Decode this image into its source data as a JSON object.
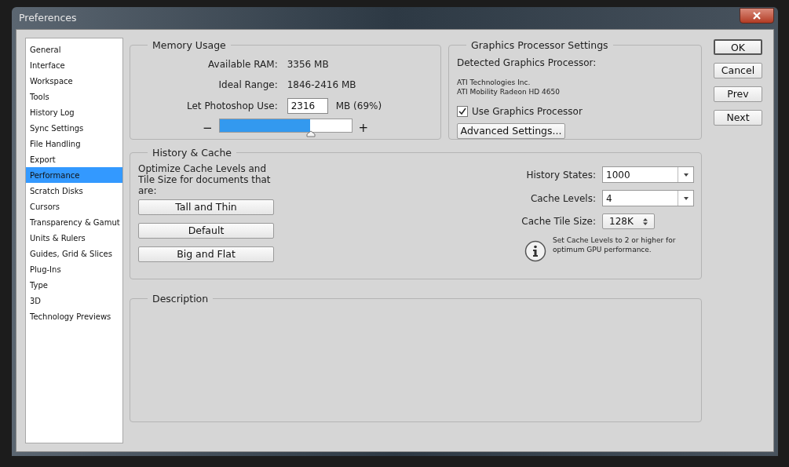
{
  "window": {
    "title": "Preferences"
  },
  "sidebar": {
    "items": [
      {
        "label": "General",
        "selected": false
      },
      {
        "label": "Interface",
        "selected": false
      },
      {
        "label": "Workspace",
        "selected": false
      },
      {
        "label": "Tools",
        "selected": false
      },
      {
        "label": "History Log",
        "selected": false
      },
      {
        "label": "Sync Settings",
        "selected": false
      },
      {
        "label": "File Handling",
        "selected": false
      },
      {
        "label": "Export",
        "selected": false
      },
      {
        "label": "Performance",
        "selected": true
      },
      {
        "label": "Scratch Disks",
        "selected": false
      },
      {
        "label": "Cursors",
        "selected": false
      },
      {
        "label": "Transparency & Gamut",
        "selected": false
      },
      {
        "label": "Units & Rulers",
        "selected": false
      },
      {
        "label": "Guides, Grid & Slices",
        "selected": false
      },
      {
        "label": "Plug-Ins",
        "selected": false
      },
      {
        "label": "Type",
        "selected": false
      },
      {
        "label": "3D",
        "selected": false
      },
      {
        "label": "Technology Previews",
        "selected": false
      }
    ]
  },
  "memory_usage": {
    "title": "Memory Usage",
    "available_label": "Available RAM:",
    "available_value": "3356 MB",
    "ideal_label": "Ideal Range:",
    "ideal_value": "1846-2416 MB",
    "use_label": "Let Photoshop Use:",
    "use_value": "2316",
    "use_percent": "MB (69%)",
    "minus": "−",
    "plus": "+",
    "level": 0.69
  },
  "gpu_settings": {
    "title": "Graphics Processor Settings",
    "detected_label": "Detected Graphics Processor:",
    "vendor": "ATI Technologies Inc.",
    "model": "ATI Mobility Radeon HD 4650",
    "use_gpu": {
      "label": "Use Graphics Processor",
      "checked": true
    },
    "advanced_button": "Advanced Settings..."
  },
  "history_cache": {
    "title": "History & Cache",
    "optimize_text": "Optimize Cache Levels and Tile Size for documents that are:",
    "preset_buttons": [
      "Tall and Thin",
      "Default",
      "Big and Flat"
    ],
    "fields": [
      {
        "label": "History States:",
        "value": "1000",
        "kind": "dropdown"
      },
      {
        "label": "Cache Levels:",
        "value": "4",
        "kind": "dropdown"
      },
      {
        "label": "Cache Tile Size:",
        "value": "128K",
        "kind": "spinner"
      }
    ],
    "info_text": "Set Cache Levels to 2 or higher for optimum GPU performance."
  },
  "description": {
    "title": "Description"
  },
  "buttons": [
    "OK",
    "Cancel",
    "Prev",
    "Next"
  ]
}
